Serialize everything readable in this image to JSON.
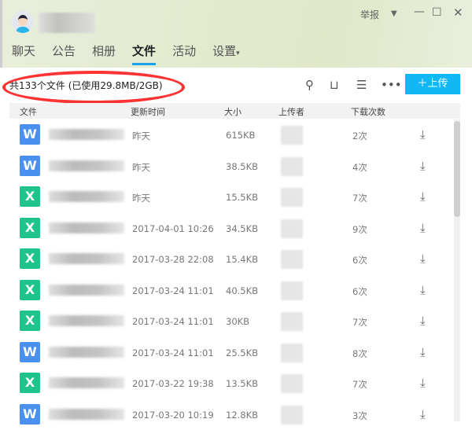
{
  "header": {
    "report": "举报",
    "tabs": [
      "聊天",
      "公告",
      "相册",
      "文件",
      "活动",
      "设置"
    ],
    "active_tab": "文件",
    "settings_caret": "▾"
  },
  "toolbar": {
    "summary": "共133个文件 (已使用29.8MB/2GB)",
    "upload_label": "上传",
    "upload_icon": "plus-icon"
  },
  "table": {
    "headers": [
      "文件",
      "更新时间",
      "大小",
      "上传者",
      "下载次数"
    ],
    "rows": [
      {
        "type": "W",
        "color": "#4a90f0",
        "time": "昨天",
        "size": "615KB",
        "count": "2次"
      },
      {
        "type": "W",
        "color": "#4a90f0",
        "time": "昨天",
        "size": "38.5KB",
        "count": "4次"
      },
      {
        "type": "X",
        "color": "#1ec48c",
        "time": "昨天",
        "size": "15.5KB",
        "count": "7次"
      },
      {
        "type": "X",
        "color": "#1ec48c",
        "time": "2017-04-01 10:26",
        "size": "34.5KB",
        "count": "9次"
      },
      {
        "type": "X",
        "color": "#1ec48c",
        "time": "2017-03-28 22:08",
        "size": "15.4KB",
        "count": "6次"
      },
      {
        "type": "X",
        "color": "#1ec48c",
        "time": "2017-03-24 11:01",
        "size": "40.5KB",
        "count": "6次"
      },
      {
        "type": "X",
        "color": "#1ec48c",
        "time": "2017-03-24 11:01",
        "size": "30KB",
        "count": "7次"
      },
      {
        "type": "W",
        "color": "#4a90f0",
        "time": "2017-03-24 11:01",
        "size": "25.5KB",
        "count": "8次"
      },
      {
        "type": "X",
        "color": "#1ec48c",
        "time": "2017-03-22 19:38",
        "size": "13.5KB",
        "count": "7次"
      },
      {
        "type": "W",
        "color": "#4a90f0",
        "time": "2017-03-20 10:19",
        "size": "12.8KB",
        "count": "3次"
      }
    ]
  }
}
